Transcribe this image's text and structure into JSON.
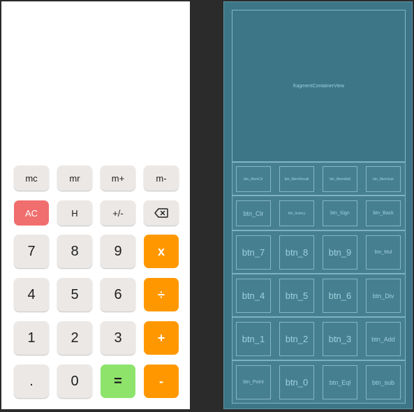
{
  "design": {
    "memory_row": [
      "mc",
      "mr",
      "m+",
      "m-"
    ],
    "func_row": {
      "clear": "AC",
      "history": "H",
      "sign": "+/-",
      "back_glyph": "⌫"
    },
    "digits": {
      "seven": "7",
      "eight": "8",
      "nine": "9",
      "four": "4",
      "five": "5",
      "six": "6",
      "one": "1",
      "two": "2",
      "three": "3",
      "point": ".",
      "zero": "0"
    },
    "ops": {
      "mul": "x",
      "div": "÷",
      "add": "+",
      "equal": "=",
      "sub": "-"
    }
  },
  "blueprint": {
    "fragment": "fragmentContainerView",
    "row1": [
      "btn_MemClr",
      "btn_MemRecall",
      "btn_MemAdd",
      "btn_MemSub"
    ],
    "row2": [
      "btn_Clr",
      "btn_history",
      "btn_Sign",
      "btn_Back"
    ],
    "row3": [
      "btn_7",
      "btn_8",
      "btn_9",
      "btn_Mul"
    ],
    "row4": [
      "btn_4",
      "btn_5",
      "btn_6",
      "btn_Div"
    ],
    "row5": [
      "btn_1",
      "btn_2",
      "btn_3",
      "btn_Add"
    ],
    "row6": [
      "btn_Point",
      "btn_0",
      "btn_Eql",
      "btn_sub"
    ]
  },
  "colors": {
    "orange": "#ff9800",
    "red": "#f06e6e",
    "green": "#8ee36b",
    "gray": "#ebe8e6",
    "blueprint": "#3c7687"
  }
}
